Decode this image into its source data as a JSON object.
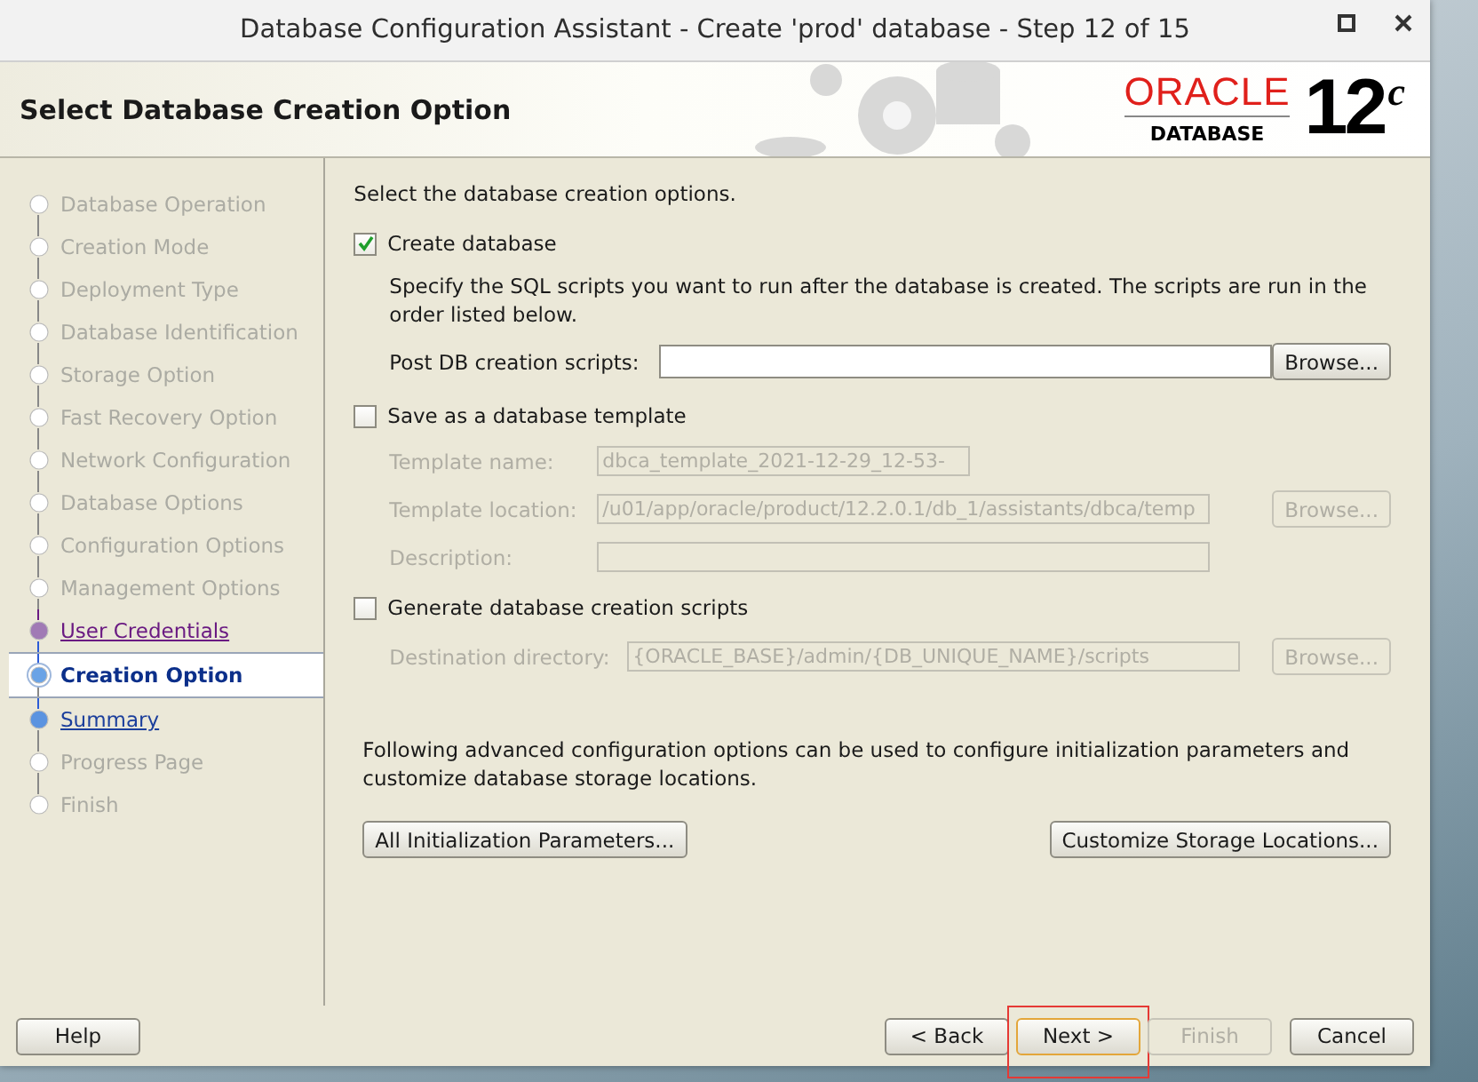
{
  "window": {
    "title": "Database Configuration Assistant - Create 'prod' database - Step 12 of 15"
  },
  "header": {
    "title": "Select Database Creation Option",
    "logo": {
      "brand": "ORACLE",
      "product": "DATABASE",
      "version": "12",
      "suffix": "c"
    }
  },
  "steps": [
    {
      "label": "Database Operation",
      "kind": "done",
      "selected": false
    },
    {
      "label": "Creation Mode",
      "kind": "done",
      "selected": false
    },
    {
      "label": "Deployment Type",
      "kind": "done",
      "selected": false
    },
    {
      "label": "Database Identification",
      "kind": "done",
      "selected": false
    },
    {
      "label": "Storage Option",
      "kind": "done",
      "selected": false
    },
    {
      "label": "Fast Recovery Option",
      "kind": "done",
      "selected": false
    },
    {
      "label": "Network Configuration",
      "kind": "done",
      "selected": false
    },
    {
      "label": "Database Options",
      "kind": "done",
      "selected": false
    },
    {
      "label": "Configuration Options",
      "kind": "done",
      "selected": false
    },
    {
      "label": "Management Options",
      "kind": "done",
      "selected": false
    },
    {
      "label": "User Credentials",
      "kind": "visited",
      "selected": false
    },
    {
      "label": "Creation Option",
      "kind": "current",
      "selected": true
    },
    {
      "label": "Summary",
      "kind": "link",
      "selected": false
    },
    {
      "label": "Progress Page",
      "kind": "done",
      "selected": false
    },
    {
      "label": "Finish",
      "kind": "done",
      "selected": false
    }
  ],
  "content": {
    "intro": "Select the database creation options.",
    "create_database": {
      "label": "Create database",
      "checked": true,
      "note": "Specify the SQL scripts you want to run after the database is created. The scripts are run in the order listed below.",
      "fields": [
        {
          "label": "Post DB creation scripts:",
          "kind": "wide",
          "disabled": false,
          "browse": "Browse..."
        }
      ]
    },
    "save_template": {
      "label": "Save as a database template",
      "checked": false,
      "fields": [
        {
          "label": "Template name:",
          "value": "dbca_template_2021-12-29_12-53-",
          "kind": "short",
          "disabled": true
        },
        {
          "label": "Template location:",
          "value": "/u01/app/oracle/product/12.2.0.1/db_1/assistants/dbca/temp",
          "kind": "wide",
          "disabled": true,
          "browse": "Browse..."
        },
        {
          "label": "Description:",
          "kind": "wide",
          "disabled": true
        }
      ]
    },
    "generate_scripts": {
      "label": "Generate database creation scripts",
      "checked": false,
      "fields": [
        {
          "label": "Destination directory:",
          "value": "{ORACLE_BASE}/admin/{DB_UNIQUE_NAME}/scripts",
          "kind": "wide",
          "disabled": true,
          "browse": "Browse..."
        }
      ]
    },
    "advanced_note": "Following advanced configuration options can be used to configure initialization parameters and customize database storage locations.",
    "advanced_buttons": [
      "All Initialization Parameters...",
      "Customize Storage Locations..."
    ]
  },
  "footer": {
    "help": "Help",
    "buttons": [
      {
        "label": "< Back",
        "disabled": false,
        "highlighted": false
      },
      {
        "label": "Next >",
        "disabled": false,
        "highlighted": true
      },
      {
        "label": "Finish",
        "disabled": true,
        "highlighted": false
      },
      {
        "label": "Cancel",
        "disabled": false,
        "highlighted": false
      }
    ]
  }
}
